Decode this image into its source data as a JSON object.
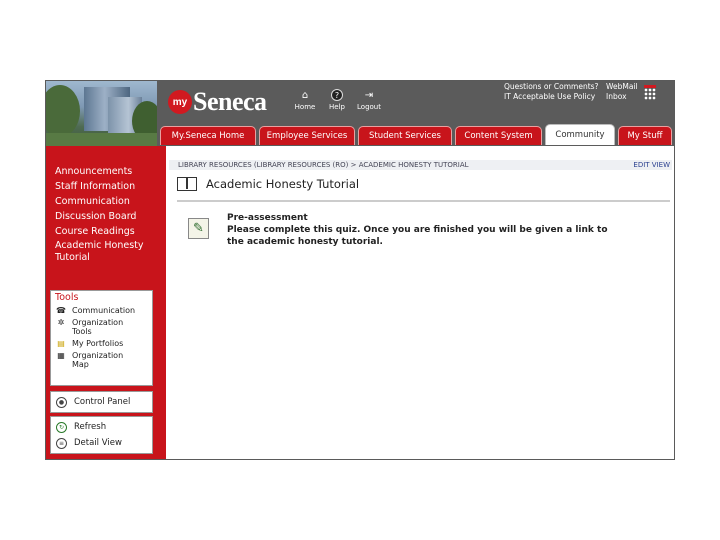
{
  "header": {
    "logo_prefix": "my",
    "logo_name": "Seneca",
    "top_links": [
      {
        "label": "Home",
        "icon": "home-icon",
        "glyph": "⌂"
      },
      {
        "label": "Help",
        "icon": "help-icon",
        "glyph": "?"
      },
      {
        "label": "Logout",
        "icon": "logout-icon",
        "glyph": "⇥"
      }
    ],
    "links_left": [
      "Questions or Comments?",
      "IT Acceptable Use Policy"
    ],
    "links_right": [
      "WebMail",
      "Inbox"
    ]
  },
  "tabs": [
    {
      "label": "My.Seneca Home",
      "active": false
    },
    {
      "label": "Employee Services",
      "active": false
    },
    {
      "label": "Student Services",
      "active": false
    },
    {
      "label": "Content System",
      "active": false
    },
    {
      "label": "Community",
      "active": true
    },
    {
      "label": "My Stuff",
      "active": false
    }
  ],
  "sidebar": {
    "nav": [
      "Announcements",
      "Staff Information",
      "Communication",
      "Discussion Board",
      "Course Readings",
      "Academic Honesty",
      "Tutorial"
    ],
    "tools_title": "Tools",
    "tools": [
      {
        "label": "Communication",
        "icon": "communication-icon",
        "glyph": "☎"
      },
      {
        "label": "Organization Tools",
        "icon": "organization-tools-icon",
        "glyph": "✲"
      },
      {
        "label": "My Portfolios",
        "icon": "portfolios-icon",
        "glyph": "▤"
      },
      {
        "label": "Organization Map",
        "icon": "organization-map-icon",
        "glyph": "▦"
      }
    ],
    "control_panel": "Control Panel",
    "refresh": "Refresh",
    "detail_view": "Detail View"
  },
  "content": {
    "breadcrumb": "LIBRARY RESOURCES (LIBRARY RESOURCES (RO) > ACADEMIC HONESTY TUTORIAL",
    "edit_view": "EDIT VIEW",
    "page_title": "Academic Honesty Tutorial",
    "item_title": "Pre-assessment",
    "item_text": "Please complete this quiz. Once you are finished you will be given a link to the academic honesty tutorial."
  }
}
